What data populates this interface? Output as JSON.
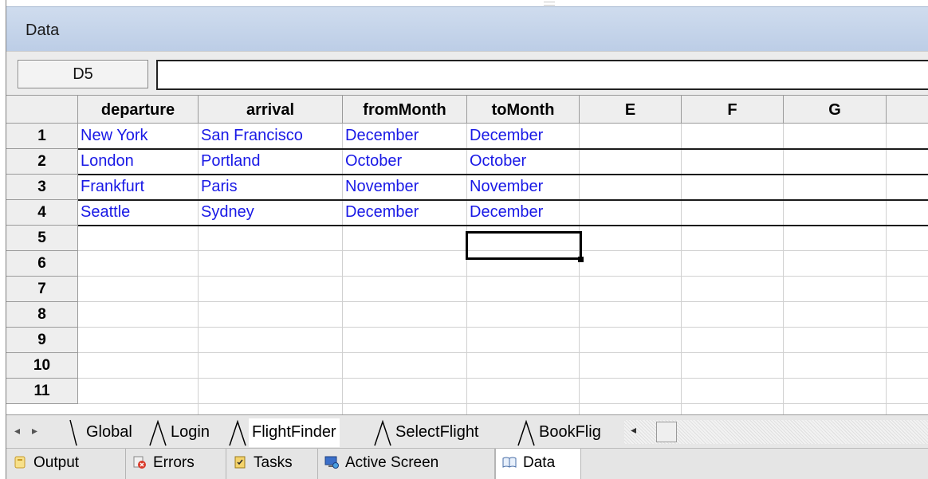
{
  "panel": {
    "title": "Data"
  },
  "formula_bar": {
    "cell_reference": "D5",
    "formula_value": ""
  },
  "grid": {
    "column_headers": [
      "departure",
      "arrival",
      "fromMonth",
      "toMonth",
      "E",
      "F",
      "G"
    ],
    "row_numbers": [
      "1",
      "2",
      "3",
      "4",
      "5",
      "6",
      "7",
      "8",
      "9",
      "10",
      "11"
    ],
    "rows": [
      [
        "New York",
        "San Francisco",
        "December",
        "December"
      ],
      [
        "London",
        "Portland",
        "October",
        "October"
      ],
      [
        "Frankfurt",
        "Paris",
        "November",
        "November"
      ],
      [
        "Seattle",
        "Sydney",
        "December",
        "December"
      ]
    ],
    "selected_cell": "D5",
    "data_text_color": "#1919e6"
  },
  "sheet_tabs": {
    "tabs": [
      "Global",
      "Login",
      "FlightFinder",
      "SelectFlight",
      "BookFlig"
    ],
    "active": "FlightFinder"
  },
  "bottom_tabs": {
    "tabs": [
      {
        "label": "Output",
        "icon": "output-icon"
      },
      {
        "label": "Errors",
        "icon": "errors-icon"
      },
      {
        "label": "Tasks",
        "icon": "tasks-icon"
      },
      {
        "label": "Active Screen",
        "icon": "active-screen-icon"
      },
      {
        "label": "Data",
        "icon": "data-book-icon"
      }
    ],
    "active": "Data"
  }
}
